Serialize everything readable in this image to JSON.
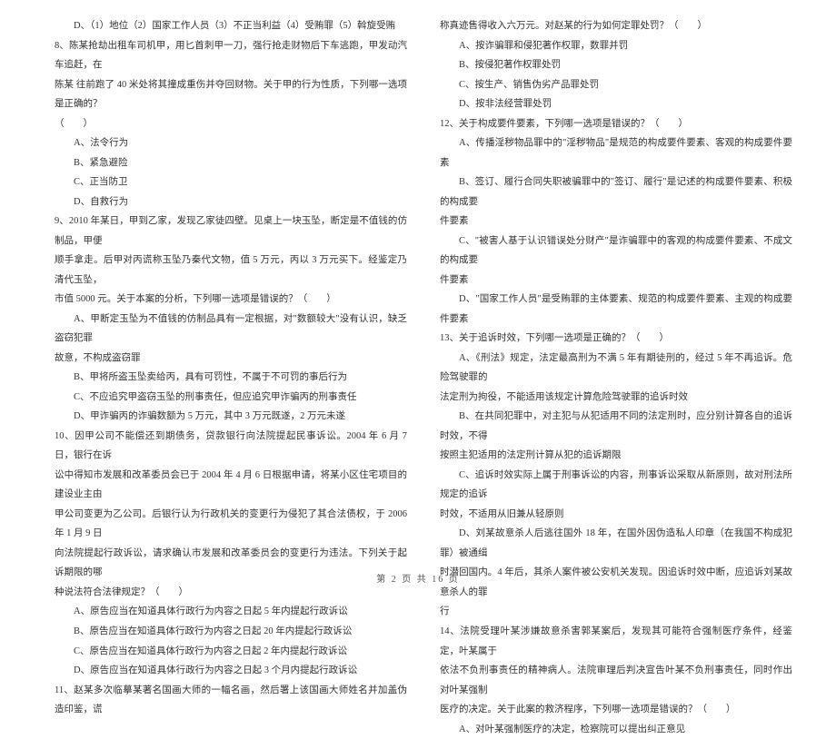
{
  "left": [
    {
      "cls": "indent",
      "t": "D、（1）地位（2）国家工作人员（3）不正当利益（4）受贿罪（5）斡旋受贿"
    },
    {
      "cls": "",
      "t": "8、陈某抢劫出租车司机甲，用匕首刺甲一刀，强行抢走财物后下车逃跑，甲发动汽车追赶，在"
    },
    {
      "cls": "",
      "t": "陈某 往前跑了 40 米处将其撞成重伤并夺回财物。关于甲的行为性质，下列哪一选项是正确的？"
    },
    {
      "cls": "",
      "t": "（　　）"
    },
    {
      "cls": "opt",
      "t": "A、法令行为"
    },
    {
      "cls": "opt",
      "t": "B、紧急避险"
    },
    {
      "cls": "opt",
      "t": "C、正当防卫"
    },
    {
      "cls": "opt",
      "t": "D、自救行为"
    },
    {
      "cls": "",
      "t": "9、2010 年某日，甲到乙家，发现乙家徒四壁。见桌上一块玉坠，断定是不值钱的仿制品，甲便"
    },
    {
      "cls": "",
      "t": "顺手拿走。后甲对丙谎称玉坠乃秦代文物，值 5 万元，丙以 3 万元买下。经鉴定乃清代玉坠，"
    },
    {
      "cls": "",
      "t": "市值 5000 元。关于本案的分析，下列哪一选项是错误的？（　　）"
    },
    {
      "cls": "opt",
      "t": "A、甲断定玉坠为不值钱的仿制品具有一定根据，对\"数额较大\"没有认识，缺乏盗窃犯罪"
    },
    {
      "cls": "",
      "t": "故意，不构成盗窃罪"
    },
    {
      "cls": "opt",
      "t": "B、甲将所盗玉坠卖给丙，具有可罚性，不属于不可罚的事后行为"
    },
    {
      "cls": "opt",
      "t": "C、不应追究甲盗窃玉坠的刑事责任，但应追究甲诈骗丙的刑事责任"
    },
    {
      "cls": "opt",
      "t": "D、甲诈骗丙的诈骗数额为 5 万元，其中 3 万元既遂，2 万元未遂"
    },
    {
      "cls": "",
      "t": "10、因甲公司不能偿还到期债务，贷款银行向法院提起民事诉讼。2004 年 6 月 7 日，银行在诉"
    },
    {
      "cls": "",
      "t": "讼中得知市发展和改革委员会已于 2004 年 4 月 6 日根据申请，将某小区住宅项目的建设业主由"
    },
    {
      "cls": "",
      "t": "甲公司变更为乙公司。后银行认为行政机关的变更行为侵犯了其合法债权，于 2006 年 1 月 9 日"
    },
    {
      "cls": "",
      "t": "向法院提起行政诉讼，请求确认市发展和改革委员会的变更行为违法。下列关于起诉期限的哪"
    },
    {
      "cls": "",
      "t": "种说法符合法律规定？（　　）"
    },
    {
      "cls": "opt",
      "t": "A、原告应当在知道具体行政行为内容之日起 5 年内提起行政诉讼"
    },
    {
      "cls": "opt",
      "t": "B、原告应当在知道具体行政行为内容之日起 20 年内提起行政诉讼"
    },
    {
      "cls": "opt",
      "t": "C、原告应当在知道具体行政行为内容之日起 2 年内提起行政诉讼"
    },
    {
      "cls": "opt",
      "t": "D、原告应当在知道具体行政行为内容之日起 3 个月内提起行政诉讼"
    },
    {
      "cls": "",
      "t": "11、赵某多次临摹某著名国画大师的一幅名画，然后署上该国画大师姓名并加盖伪造印鉴，谎"
    }
  ],
  "right": [
    {
      "cls": "",
      "t": "称真迹售得收入六万元。对赵某的行为如何定罪处罚？（　　）"
    },
    {
      "cls": "opt",
      "t": "A、按诈骗罪和侵犯著作权罪，数罪并罚"
    },
    {
      "cls": "opt",
      "t": "B、按侵犯著作权罪处罚"
    },
    {
      "cls": "opt",
      "t": "C、按生产、销售伪劣产品罪处罚"
    },
    {
      "cls": "opt",
      "t": "D、按非法经营罪处罚"
    },
    {
      "cls": "",
      "t": "12、关于构成要件要素，下列哪一选项是错误的？（　　）"
    },
    {
      "cls": "opt",
      "t": "A、传播淫秽物品罪中的\"淫秽物品\"是规范的构成要件要素、客观的构成要件要素"
    },
    {
      "cls": "opt",
      "t": "B、签订、履行合同失职被骗罪中的\"签订、履行\"是记述的构成要件要素、积极的构成要"
    },
    {
      "cls": "",
      "t": "件要素"
    },
    {
      "cls": "opt",
      "t": "C、\"被害人基于认识错误处分财产\"是诈骗罪中的客观的构成要件要素、不成文的构成要"
    },
    {
      "cls": "",
      "t": "件要素"
    },
    {
      "cls": "opt",
      "t": "D、\"国家工作人员\"是受贿罪的主体要素、规范的构成要件要素、主观的构成要件要素"
    },
    {
      "cls": "",
      "t": "13、关于追诉时效，下列哪一选项是正确的？（　　）"
    },
    {
      "cls": "opt",
      "t": "A、《刑法》规定，法定最高刑为不满 5 年有期徒刑的，经过 5 年不再追诉。危险驾驶罪的"
    },
    {
      "cls": "",
      "t": "法定刑为拘役，不能适用该规定计算危险驾驶罪的追诉时效"
    },
    {
      "cls": "opt",
      "t": "B、在共同犯罪中，对主犯与从犯适用不同的法定刑时，应分别计算各自的追诉时效，不得"
    },
    {
      "cls": "",
      "t": "按照主犯适用的法定刑计算从犯的追诉期限"
    },
    {
      "cls": "opt",
      "t": "C、追诉时效实际上属于刑事诉讼的内容，刑事诉讼采取从新原则，故对刑法所规定的追诉"
    },
    {
      "cls": "",
      "t": "时效，不适用从旧兼从轻原则"
    },
    {
      "cls": "opt",
      "t": "D、刘某故意杀人后逃往国外 18 年，在国外因伪造私人印章（在我国不构成犯罪）被通缉"
    },
    {
      "cls": "",
      "t": "时潜回国内。4 年后，其杀人案件被公安机关发现。因追诉时效中断，应追诉刘某故意杀人的罪"
    },
    {
      "cls": "",
      "t": "行"
    },
    {
      "cls": "",
      "t": "14、法院受理叶某涉嫌故意杀害郭某案后，发现其可能符合强制医疗条件，经鉴定，叶某属于"
    },
    {
      "cls": "",
      "t": "依法不负刑事责任的精神病人。法院审理后判决宣告叶某不负刑事责任，同时作出对叶某强制"
    },
    {
      "cls": "",
      "t": "医疗的决定。关于此案的救济程序，下列哪一选项是错误的？（　　）"
    },
    {
      "cls": "opt",
      "t": "A、对叶某强制医疗的决定，检察院可以提出纠正意见"
    }
  ],
  "footer": "第 2 页 共 16 页"
}
